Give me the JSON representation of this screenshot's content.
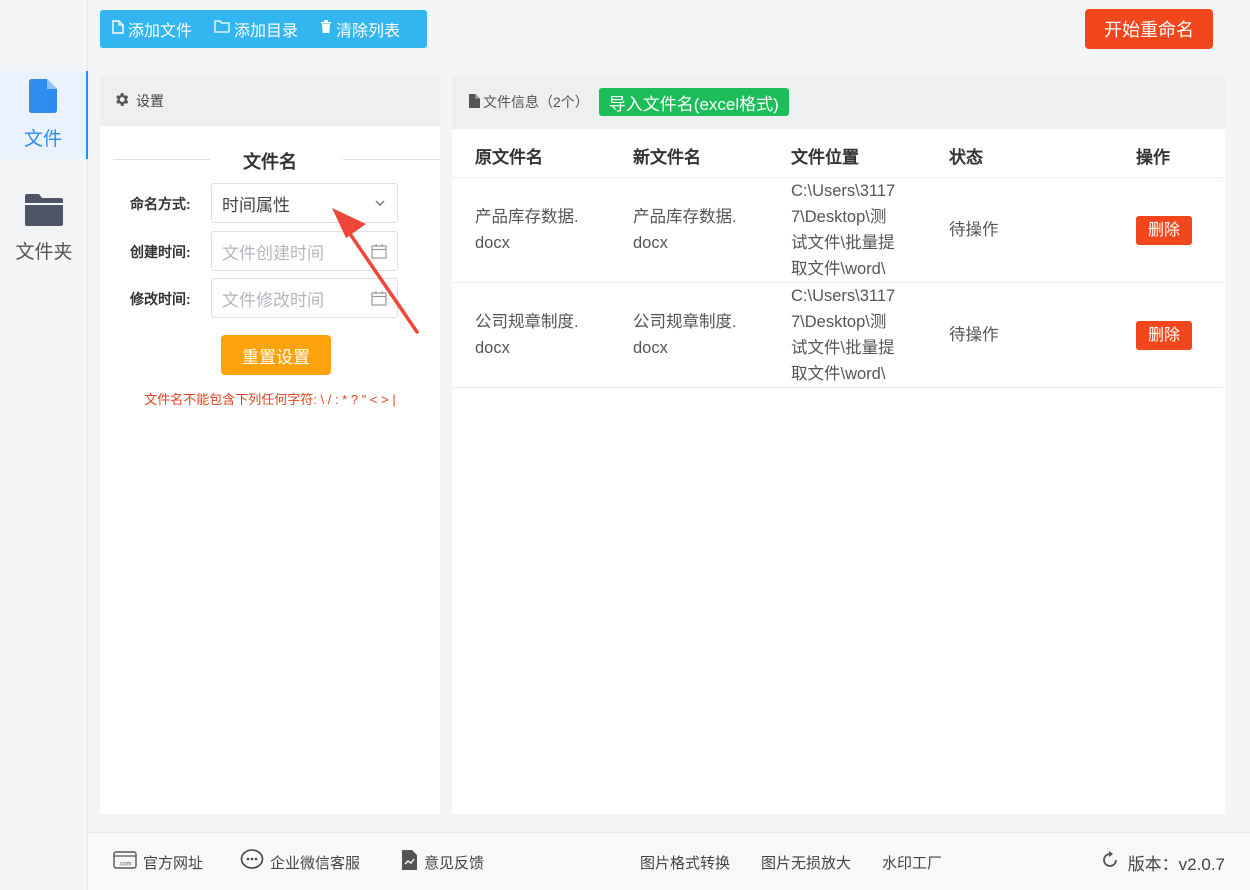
{
  "toolbar": {
    "add_file": "添加文件",
    "add_dir": "添加目录",
    "clear_list": "清除列表",
    "start": "开始重命名"
  },
  "nav": {
    "items": [
      {
        "label": "文件",
        "icon": "file-icon",
        "active": true
      },
      {
        "label": "文件夹",
        "icon": "folder-icon",
        "active": false
      }
    ]
  },
  "settings": {
    "header": "设置",
    "section_title": "文件名",
    "naming_label": "命名方式:",
    "naming_value": "时间属性",
    "created_label": "创建时间:",
    "created_placeholder": "文件创建时间",
    "modified_label": "修改时间:",
    "modified_placeholder": "文件修改时间",
    "reset": "重置设置",
    "warning": "文件名不能包含下列任何字符: \\ / : * ? \" < > |"
  },
  "files": {
    "header": "文件信息（2个）",
    "import": "导入文件名(excel格式)",
    "columns": [
      "原文件名",
      "新文件名",
      "文件位置",
      "状态",
      "操作"
    ],
    "rows": [
      {
        "orig": [
          "产品库存数据.",
          "docx"
        ],
        "new": [
          "产品库存数据.",
          "docx"
        ],
        "path": [
          "C:\\Users\\3117",
          "7\\Desktop\\测",
          "试文件\\批量提",
          "取文件\\word\\"
        ],
        "status": "待操作",
        "action": "删除"
      },
      {
        "orig": [
          "公司规章制度.",
          "docx"
        ],
        "new": [
          "公司规章制度.",
          "docx"
        ],
        "path": [
          "C:\\Users\\3117",
          "7\\Desktop\\测",
          "试文件\\批量提",
          "取文件\\word\\"
        ],
        "status": "待操作",
        "action": "删除"
      }
    ]
  },
  "footer": {
    "website": "官方网址",
    "wechat": "企业微信客服",
    "feedback": "意见反馈",
    "link1": "图片格式转换",
    "link2": "图片无损放大",
    "link3": "水印工厂",
    "version": "版本：v2.0.7"
  },
  "colors": {
    "toolbar_bg": "#33b5f0",
    "start_bg": "#f2471c",
    "reset_bg": "#fca20b",
    "import_bg": "#1dbd5a",
    "delete_bg": "#f2471c",
    "active_blue": "#2f8cf0"
  }
}
